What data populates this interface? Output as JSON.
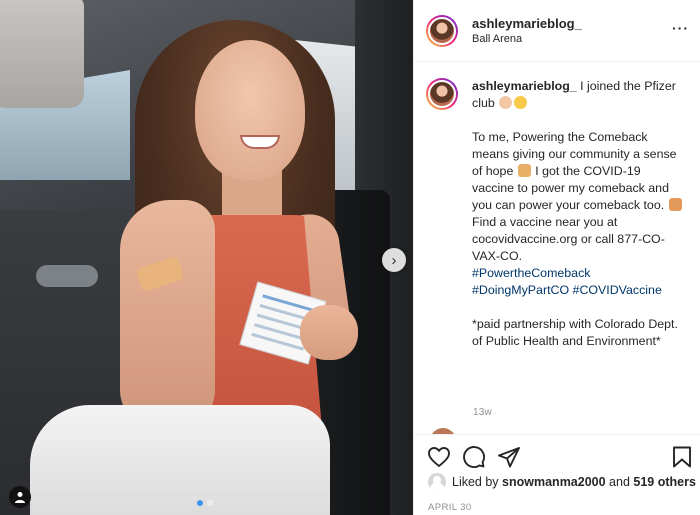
{
  "post": {
    "username": "ashleymarieblog_",
    "location": "Ball Arena",
    "more_icon": "more-horizontal-icon",
    "caption": {
      "username": "ashleymarieblog_",
      "line1": " I joined the Pfizer club",
      "para2_a": "To me, Powering the Comeback means giving our community a sense of hope",
      "para2_b": " I got the COVID-19 vaccine to power my comeback and you can power your comeback too. ",
      "para2_c": " Find a vaccine near you at cocovidvaccine.org or call 877-CO-VAX-CO.",
      "hashtags": [
        "#PowertheComeback",
        "#DoingMyPartCO",
        "#COVIDVaccine"
      ],
      "para3": "*paid partnership with Colorado Dept. of Public Health and Environment*"
    },
    "time_ago": "13w",
    "likes": {
      "prefix": "Liked by ",
      "user": "snowmanma2000",
      "middle": " and ",
      "others": "519 others"
    },
    "date": "APRIL 30"
  },
  "carousel": {
    "next_icon": "chevron-right-icon",
    "current_slide": 1,
    "total_slides": 2
  },
  "colors": {
    "accent_blue": "#3897f0",
    "hashtag": "#00376b",
    "muted": "#8e8e8e",
    "text": "#262626"
  }
}
